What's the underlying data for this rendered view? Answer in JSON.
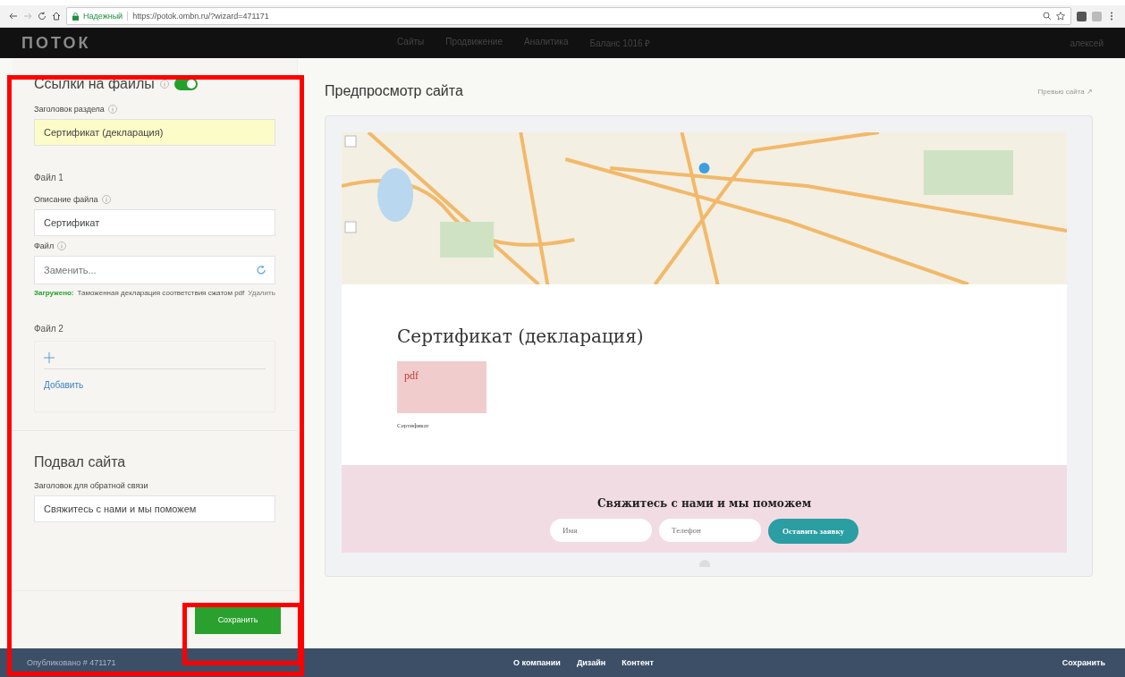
{
  "browser": {
    "secure_label": "Надежный",
    "url": "https://potok.ombn.ru/?wizard=471171"
  },
  "header": {
    "logo": "ПОТОК",
    "nav": [
      "Сайты",
      "Продвижение",
      "Аналитика",
      "Баланс 1016 ₽"
    ],
    "user": "алексей"
  },
  "editor": {
    "section_title": "Ссылки на файлы",
    "section_enabled": true,
    "heading_label": "Заголовок раздела",
    "heading_value": "Сертификат (декларация)",
    "files": [
      {
        "kind": "filled",
        "title": "Файл 1",
        "desc_label": "Описание файла",
        "desc_value": "Сертификат",
        "file_label": "Файл",
        "file_placeholder": "Заменить...",
        "uploaded_label": "Загружено:",
        "uploaded_name": "Таможенная декларация соответствия сжатом pdf",
        "remove": "Удалить"
      },
      {
        "kind": "empty",
        "title": "Файл 2",
        "add": "Добавить"
      }
    ],
    "footer_title": "Подвал сайта",
    "footer_label": "Заголовок для обратной связи",
    "footer_value": "Свяжитесь с нами и мы поможем",
    "save": "Сохранить",
    "published": "Опубликовано # 471171"
  },
  "preview": {
    "title": "Предпросмотр сайта",
    "link": "Превью сайта ↗",
    "section_heading": "Сертификат (декларация)",
    "file_badge": "pdf",
    "file_caption": "Сертификат",
    "contact_title": "Свяжитесь с нами и мы поможем",
    "name_placeholder": "Имя",
    "phone_placeholder": "Телефон",
    "submit": "Оставить заявку"
  },
  "bottom_bar": {
    "links": [
      "О компании",
      "Дизайн",
      "Контент"
    ],
    "save": "Сохранить"
  }
}
